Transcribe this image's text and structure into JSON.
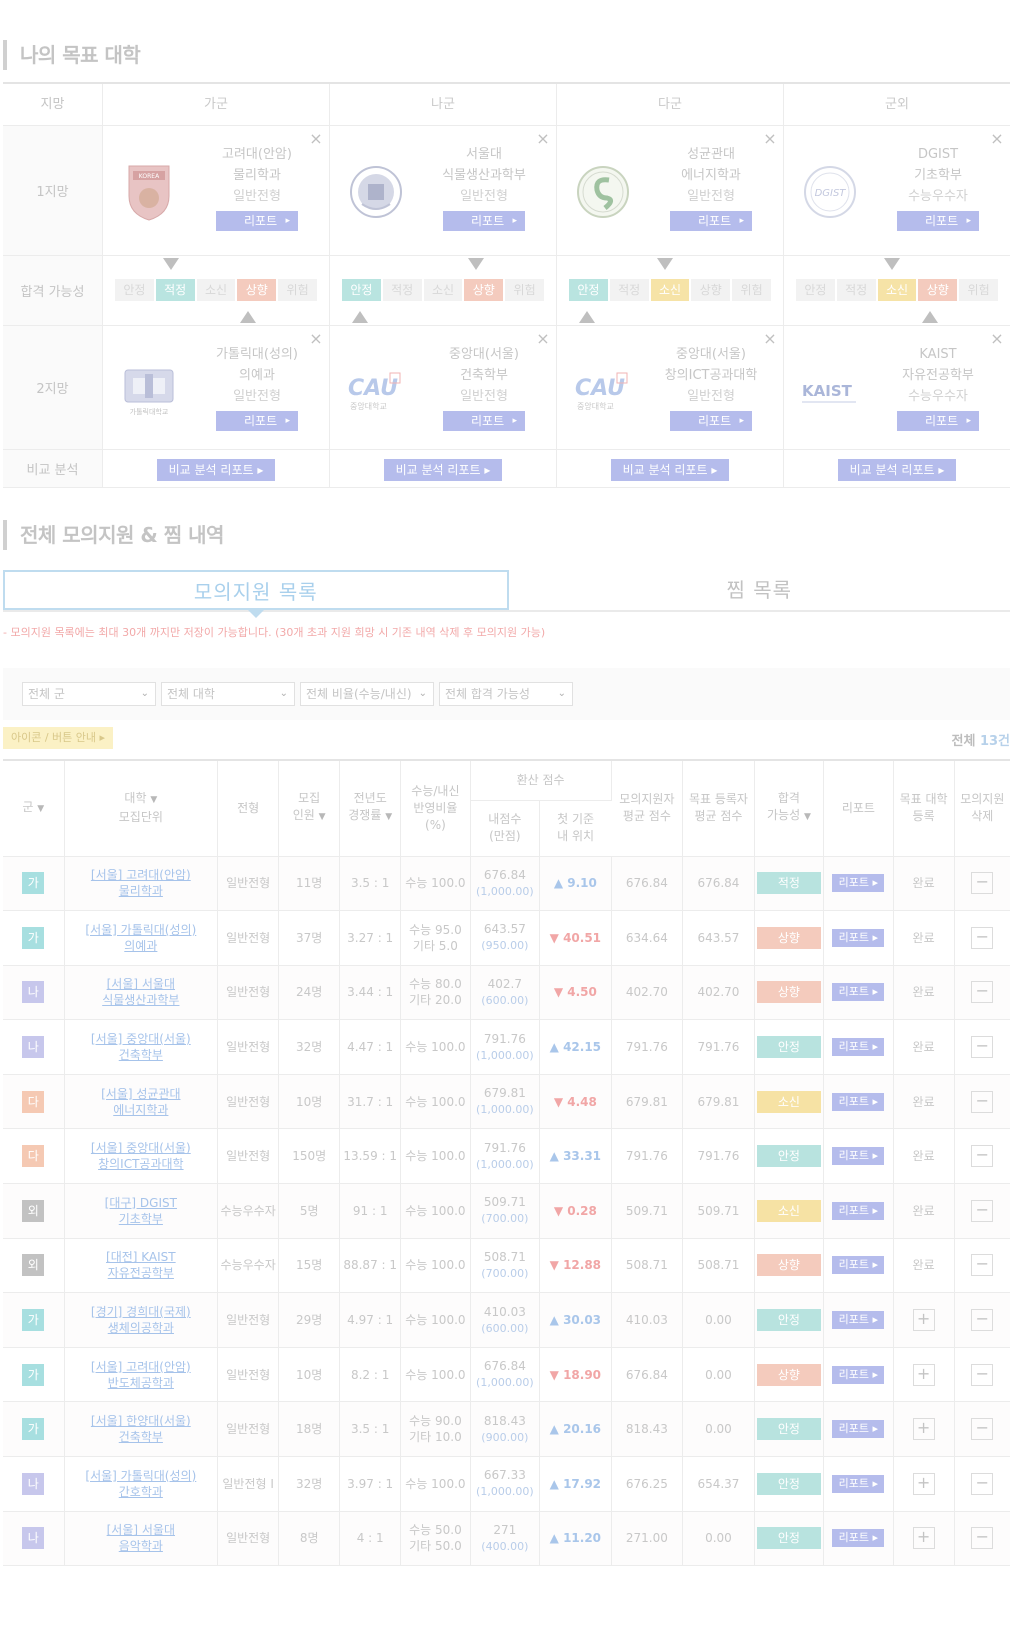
{
  "section1_title": "나의 목표 대학",
  "target": {
    "col_label": "지망",
    "groups": [
      "가군",
      "나군",
      "다군",
      "군외"
    ],
    "row1_label": "1지망",
    "row_poss_label": "합격 가능성",
    "row2_label": "2지망",
    "row_cmp_label": "비교 분석",
    "first": [
      {
        "univ": "고려대(안암)",
        "dept": "물리학과",
        "adm": "일반전형"
      },
      {
        "univ": "서울대",
        "dept": "식물생산과학부",
        "adm": "일반전형"
      },
      {
        "univ": "성균관대",
        "dept": "에너지학과",
        "adm": "일반전형"
      },
      {
        "univ": "DGIST",
        "dept": "기초학부",
        "adm": "수능우수자"
      }
    ],
    "second": [
      {
        "univ": "가톨릭대(성의)",
        "dept": "의예과",
        "adm": "일반전형"
      },
      {
        "univ": "중앙대(서울)",
        "dept": "건축학부",
        "adm": "일반전형"
      },
      {
        "univ": "중앙대(서울)",
        "dept": "창의ICT공과대학",
        "adm": "일반전형"
      },
      {
        "univ": "KAIST",
        "dept": "자유전공학부",
        "adm": "수능우수자"
      }
    ],
    "report_label": "리포트",
    "compare_label": "비교 분석 리포트",
    "possibility_levels": [
      "안정",
      "적정",
      "소신",
      "상향",
      "위험"
    ],
    "logo_texts": {
      "korea": "KOREA",
      "cau": "CAU",
      "cau_sub": "중앙대학교",
      "catholic_sub": "가톨릭대학교",
      "kaist": "KAIST",
      "dgist": "DGIST"
    }
  },
  "section2_title": "전체 모의지원 & 찜 내역",
  "tabs": {
    "mock": "모의지원 목록",
    "fav": "찜 목록"
  },
  "notice": "- 모의지원 목록에는 최대 30개 까지만 저장이 가능합니다. (30개 초과 지원 희망 시 기존 내역 삭제 후 모의지원 가능)",
  "filters": [
    "전체 군",
    "전체 대학",
    "전체 비율(수능/내신)",
    "전체 합격 가능성"
  ],
  "guide_label": "아이콘 / 버튼 안내",
  "total": {
    "label": "전체",
    "count": "13건"
  },
  "columns": {
    "gun": "군",
    "univ": "대학",
    "unit": "모집단위",
    "adm": "전형",
    "quota1": "모집",
    "quota2": "인원",
    "comp1": "전년도",
    "comp2": "경쟁률",
    "ratio1": "수능/내신",
    "ratio2": "반영비율",
    "ratio3": "(%)",
    "score_group": "환산 점수",
    "my1": "내점수",
    "my2": "(만점)",
    "first1": "첫 기준",
    "first2": "내 위치",
    "avg1": "모의지원자",
    "avg2": "평균 점수",
    "reg1": "목표 등록자",
    "reg2": "평균 점수",
    "poss1": "합격",
    "poss2": "가능성",
    "report": "리포트",
    "goal1": "목표 대학",
    "goal2": "등록",
    "del1": "모의지원",
    "del2": "삭제"
  },
  "rows": [
    {
      "gun": "가",
      "gc": "ga",
      "univ": "[서울] 고려대(안암)",
      "dept": "물리학과",
      "adm": "일반전형",
      "quota": "11명",
      "comp": "3.5 : 1",
      "ratio": [
        "수능 100.0"
      ],
      "score": "676.84",
      "max": "(1,000.00)",
      "dir": "up",
      "first": "9.10",
      "avg": "676.84",
      "reg": "676.84",
      "poss": "적정",
      "pc": "ap",
      "goal": "완료"
    },
    {
      "gun": "가",
      "gc": "ga",
      "univ": "[서울] 가톨릭대(성의)",
      "dept": "의예과",
      "adm": "일반전형",
      "quota": "37명",
      "comp": "3.27 : 1",
      "ratio": [
        "수능 95.0",
        "기타 5.0"
      ],
      "score": "643.57",
      "max": "(950.00)",
      "dir": "down",
      "first": "40.51",
      "avg": "634.64",
      "reg": "643.57",
      "poss": "상향",
      "pc": "sh",
      "goal": "완료"
    },
    {
      "gun": "나",
      "gc": "na",
      "univ": "[서울] 서울대",
      "dept": "식물생산과학부",
      "adm": "일반전형",
      "quota": "24명",
      "comp": "3.44 : 1",
      "ratio": [
        "수능 80.0",
        "기타 20.0"
      ],
      "score": "402.7",
      "max": "(600.00)",
      "dir": "down",
      "first": "4.50",
      "avg": "402.70",
      "reg": "402.70",
      "poss": "상향",
      "pc": "sh",
      "goal": "완료"
    },
    {
      "gun": "나",
      "gc": "na",
      "univ": "[서울] 중앙대(서울)",
      "dept": "건축학부",
      "adm": "일반전형",
      "quota": "32명",
      "comp": "4.47 : 1",
      "ratio": [
        "수능 100.0"
      ],
      "score": "791.76",
      "max": "(1,000.00)",
      "dir": "up",
      "first": "42.15",
      "avg": "791.76",
      "reg": "791.76",
      "poss": "안정",
      "pc": "ap",
      "goal": "완료"
    },
    {
      "gun": "다",
      "gc": "da",
      "univ": "[서울] 성균관대",
      "dept": "에너지학과",
      "adm": "일반전형",
      "quota": "10명",
      "comp": "31.7 : 1",
      "ratio": [
        "수능 100.0"
      ],
      "score": "679.81",
      "max": "(1,000.00)",
      "dir": "down",
      "first": "4.48",
      "avg": "679.81",
      "reg": "679.81",
      "poss": "소신",
      "pc": "so",
      "goal": "완료"
    },
    {
      "gun": "다",
      "gc": "da",
      "univ": "[서울] 중앙대(서울)",
      "dept": "창의ICT공과대학",
      "adm": "일반전형",
      "quota": "150명",
      "comp": "13.59 : 1",
      "ratio": [
        "수능 100.0"
      ],
      "score": "791.76",
      "max": "(1,000.00)",
      "dir": "up",
      "first": "33.31",
      "avg": "791.76",
      "reg": "791.76",
      "poss": "안정",
      "pc": "ap",
      "goal": "완료"
    },
    {
      "gun": "외",
      "gc": "oe",
      "univ": "[대구] DGIST",
      "dept": "기초학부",
      "adm": "수능우수자",
      "quota": "5명",
      "comp": "91 : 1",
      "ratio": [
        "수능 100.0"
      ],
      "score": "509.71",
      "max": "(700.00)",
      "dir": "down",
      "first": "0.28",
      "avg": "509.71",
      "reg": "509.71",
      "poss": "소신",
      "pc": "so",
      "goal": "완료"
    },
    {
      "gun": "외",
      "gc": "oe",
      "univ": "[대전] KAIST",
      "dept": "자유전공학부",
      "adm": "수능우수자",
      "quota": "15명",
      "comp": "88.87 : 1",
      "ratio": [
        "수능 100.0"
      ],
      "score": "508.71",
      "max": "(700.00)",
      "dir": "down",
      "first": "12.88",
      "avg": "508.71",
      "reg": "508.71",
      "poss": "상향",
      "pc": "sh",
      "goal": "완료"
    },
    {
      "gun": "가",
      "gc": "ga",
      "univ": "[경기] 경희대(국제)",
      "dept": "생체의공학과",
      "adm": "일반전형",
      "quota": "29명",
      "comp": "4.97 : 1",
      "ratio": [
        "수능 100.0"
      ],
      "score": "410.03",
      "max": "(600.00)",
      "dir": "up",
      "first": "30.03",
      "avg": "410.03",
      "reg": "0.00",
      "poss": "안정",
      "pc": "ap",
      "goal": "+"
    },
    {
      "gun": "가",
      "gc": "ga",
      "univ": "[서울] 고려대(안암)",
      "dept": "반도체공학과",
      "adm": "일반전형",
      "quota": "10명",
      "comp": "8.2 : 1",
      "ratio": [
        "수능 100.0"
      ],
      "score": "676.84",
      "max": "(1,000.00)",
      "dir": "down",
      "first": "18.90",
      "avg": "676.84",
      "reg": "0.00",
      "poss": "상향",
      "pc": "sh",
      "goal": "+"
    },
    {
      "gun": "가",
      "gc": "ga",
      "univ": "[서울] 한양대(서울)",
      "dept": "건축학부",
      "adm": "일반전형",
      "quota": "18명",
      "comp": "3.5 : 1",
      "ratio": [
        "수능 90.0",
        "기타 10.0"
      ],
      "score": "818.43",
      "max": "(900.00)",
      "dir": "up",
      "first": "20.16",
      "avg": "818.43",
      "reg": "0.00",
      "poss": "안정",
      "pc": "ap",
      "goal": "+"
    },
    {
      "gun": "나",
      "gc": "na",
      "univ": "[서울] 가톨릭대(성의)",
      "dept": "간호학과",
      "adm": "일반전형 I",
      "quota": "32명",
      "comp": "3.97 : 1",
      "ratio": [
        "수능 100.0"
      ],
      "score": "667.33",
      "max": "(1,000.00)",
      "dir": "up",
      "first": "17.92",
      "avg": "676.25",
      "reg": "654.37",
      "poss": "안정",
      "pc": "ap",
      "goal": "+"
    },
    {
      "gun": "나",
      "gc": "na",
      "univ": "[서울] 서울대",
      "dept": "음악학과",
      "adm": "일반전형",
      "quota": "8명",
      "comp": "4 : 1",
      "ratio": [
        "수능 50.0",
        "기타 50.0"
      ],
      "score": "271",
      "max": "(400.00)",
      "dir": "up",
      "first": "11.20",
      "avg": "271.00",
      "reg": "0.00",
      "poss": "안정",
      "pc": "ap",
      "goal": "+"
    }
  ]
}
